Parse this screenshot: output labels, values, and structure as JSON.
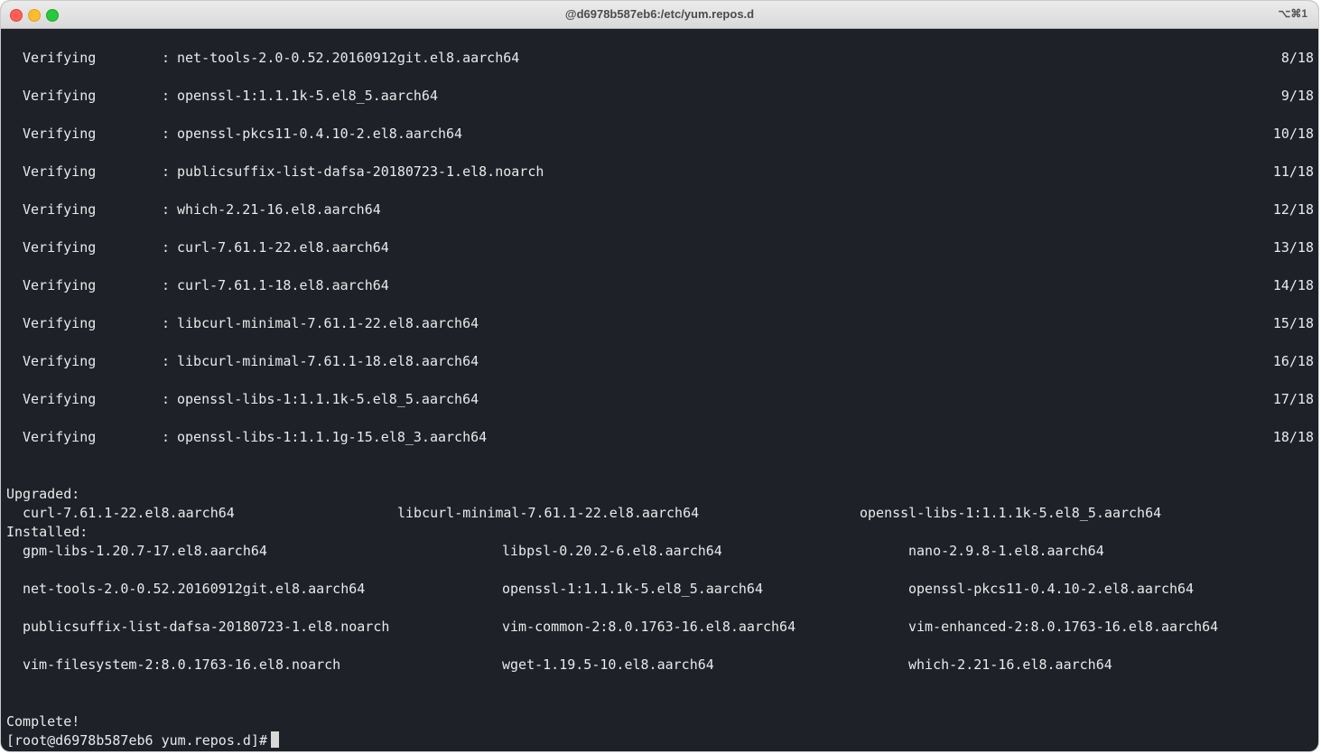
{
  "window": {
    "title": "@d6978b587eb6:/etc/yum.repos.d",
    "shortcut": "⌥⌘1"
  },
  "verifying": [
    {
      "label": "Verifying",
      "sep": ":",
      "package": "net-tools-2.0-0.52.20160912git.el8.aarch64",
      "count": "8/18"
    },
    {
      "label": "Verifying",
      "sep": ":",
      "package": "openssl-1:1.1.1k-5.el8_5.aarch64",
      "count": "9/18"
    },
    {
      "label": "Verifying",
      "sep": ":",
      "package": "openssl-pkcs11-0.4.10-2.el8.aarch64",
      "count": "10/18"
    },
    {
      "label": "Verifying",
      "sep": ":",
      "package": "publicsuffix-list-dafsa-20180723-1.el8.noarch",
      "count": "11/18"
    },
    {
      "label": "Verifying",
      "sep": ":",
      "package": "which-2.21-16.el8.aarch64",
      "count": "12/18"
    },
    {
      "label": "Verifying",
      "sep": ":",
      "package": "curl-7.61.1-22.el8.aarch64",
      "count": "13/18"
    },
    {
      "label": "Verifying",
      "sep": ":",
      "package": "curl-7.61.1-18.el8.aarch64",
      "count": "14/18"
    },
    {
      "label": "Verifying",
      "sep": ":",
      "package": "libcurl-minimal-7.61.1-22.el8.aarch64",
      "count": "15/18"
    },
    {
      "label": "Verifying",
      "sep": ":",
      "package": "libcurl-minimal-7.61.1-18.el8.aarch64",
      "count": "16/18"
    },
    {
      "label": "Verifying",
      "sep": ":",
      "package": "openssl-libs-1:1.1.1k-5.el8_5.aarch64",
      "count": "17/18"
    },
    {
      "label": "Verifying",
      "sep": ":",
      "package": "openssl-libs-1:1.1.1g-15.el8_3.aarch64",
      "count": "18/18"
    }
  ],
  "upgraded": {
    "header": "Upgraded:",
    "packages": [
      "curl-7.61.1-22.el8.aarch64",
      "libcurl-minimal-7.61.1-22.el8.aarch64",
      "openssl-libs-1:1.1.1k-5.el8_5.aarch64"
    ]
  },
  "installed": {
    "header": "Installed:",
    "rows": [
      [
        "gpm-libs-1.20.7-17.el8.aarch64",
        "libpsl-0.20.2-6.el8.aarch64",
        "nano-2.9.8-1.el8.aarch64"
      ],
      [
        "net-tools-2.0-0.52.20160912git.el8.aarch64",
        "openssl-1:1.1.1k-5.el8_5.aarch64",
        "openssl-pkcs11-0.4.10-2.el8.aarch64"
      ],
      [
        "publicsuffix-list-dafsa-20180723-1.el8.noarch",
        "vim-common-2:8.0.1763-16.el8.aarch64",
        "vim-enhanced-2:8.0.1763-16.el8.aarch64"
      ],
      [
        "vim-filesystem-2:8.0.1763-16.el8.noarch",
        "wget-1.19.5-10.el8.aarch64",
        "which-2.21-16.el8.aarch64"
      ]
    ]
  },
  "complete": "Complete!",
  "prompt": "[root@d6978b587eb6 yum.repos.d]#"
}
